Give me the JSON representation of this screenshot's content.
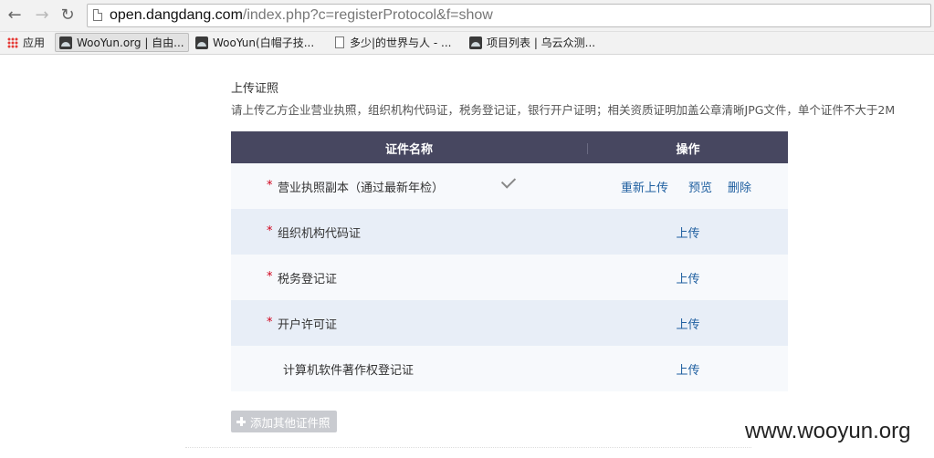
{
  "browser": {
    "url_host": "open.dangdang.com",
    "url_path": "/index.php?c=registerProtocol&f=show",
    "nav_back": "←",
    "nav_forward": "→",
    "nav_reload": "↻",
    "bookmarks": [
      {
        "label": "应用",
        "icon": "apps-grid-icon"
      },
      {
        "label": "WooYun.org | 自由...",
        "icon": "wooyun-favicon",
        "active": true
      },
      {
        "label": "WooYun(白帽子技...",
        "icon": "wooyun-favicon"
      },
      {
        "label": "多少|的世界与人 - ...",
        "icon": "document-icon"
      },
      {
        "label": "项目列表 | 乌云众测...",
        "icon": "wooyun-favicon"
      }
    ]
  },
  "upload": {
    "title": "上传证照",
    "description": "请上传乙方企业营业执照，组织机构代码证，税务登记证，银行开户证明；相关资质证明加盖公章清晰JPG文件，单个证件不大于2M",
    "table": {
      "header_name": "证件名称",
      "header_ops": "操作",
      "rows": [
        {
          "required": "*",
          "name": "营业执照副本（通过最新年检）",
          "uploaded": true,
          "ops": [
            "重新上传",
            "预览",
            "删除"
          ]
        },
        {
          "required": "*",
          "name": "组织机构代码证",
          "uploaded": false,
          "ops": [
            "上传"
          ]
        },
        {
          "required": "*",
          "name": "税务登记证",
          "uploaded": false,
          "ops": [
            "上传"
          ]
        },
        {
          "required": "*",
          "name": "开户许可证",
          "uploaded": false,
          "ops": [
            "上传"
          ]
        },
        {
          "required": "",
          "name": "计算机软件著作权登记证",
          "uploaded": false,
          "ops": [
            "上传"
          ]
        }
      ]
    },
    "add_button": "添加其他证件照"
  },
  "watermark": "www.wooyun.org"
}
